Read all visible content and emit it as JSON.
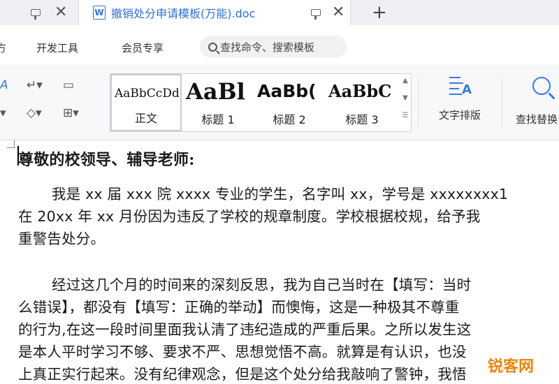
{
  "tabs": {
    "active_title": "撤销处分申请模板(万能).doc",
    "active_icon": "W",
    "new_tab_label": "+",
    "close_label": "✕"
  },
  "menu": {
    "items": [
      "方",
      "开发工具",
      "会员专享"
    ],
    "search_text": "查找命令、搜索模板"
  },
  "ribbon": {
    "styles": [
      {
        "sample": "AaBbCcDd",
        "label": "正文"
      },
      {
        "sample": "AaBl",
        "label": "标题 1"
      },
      {
        "sample": "AaBb(",
        "label": "标题 2"
      },
      {
        "sample": "AaBbC",
        "label": "标题 3"
      }
    ],
    "text_layout_label": "文字排版",
    "find_replace_label": "查找替换"
  },
  "document": {
    "heading": "尊敬的校领导、辅导老师:",
    "lines": [
      "我是 xx 届 xxx 院 xxxx 专业的学生，名字叫 xx，学号是 xxxxxxxx1",
      "在 20xx 年 xx 月份因为违反了学校的规章制度。学校根据校规，给予我",
      "重警告处分。",
      "经过这几个月的时间来的深刻反思，我为自己当时在【填写：当时",
      "么错误】，都没有【填写：正确的举动】而懊悔，这是一种极其不尊重",
      "的行为,在这一段时间里面我认清了违纪造成的严重后果。之所以发生这",
      "是本人平时学习不够、要求不严、思想觉悟不高。就算是有认识，也没",
      "上真正实行起来。没有纪律观念，但是这个处分给我敲响了警钟，我悟"
    ]
  },
  "watermark": "锐客网",
  "colors": {
    "accent": "#2f6fd6",
    "watermark": "#e98512"
  }
}
